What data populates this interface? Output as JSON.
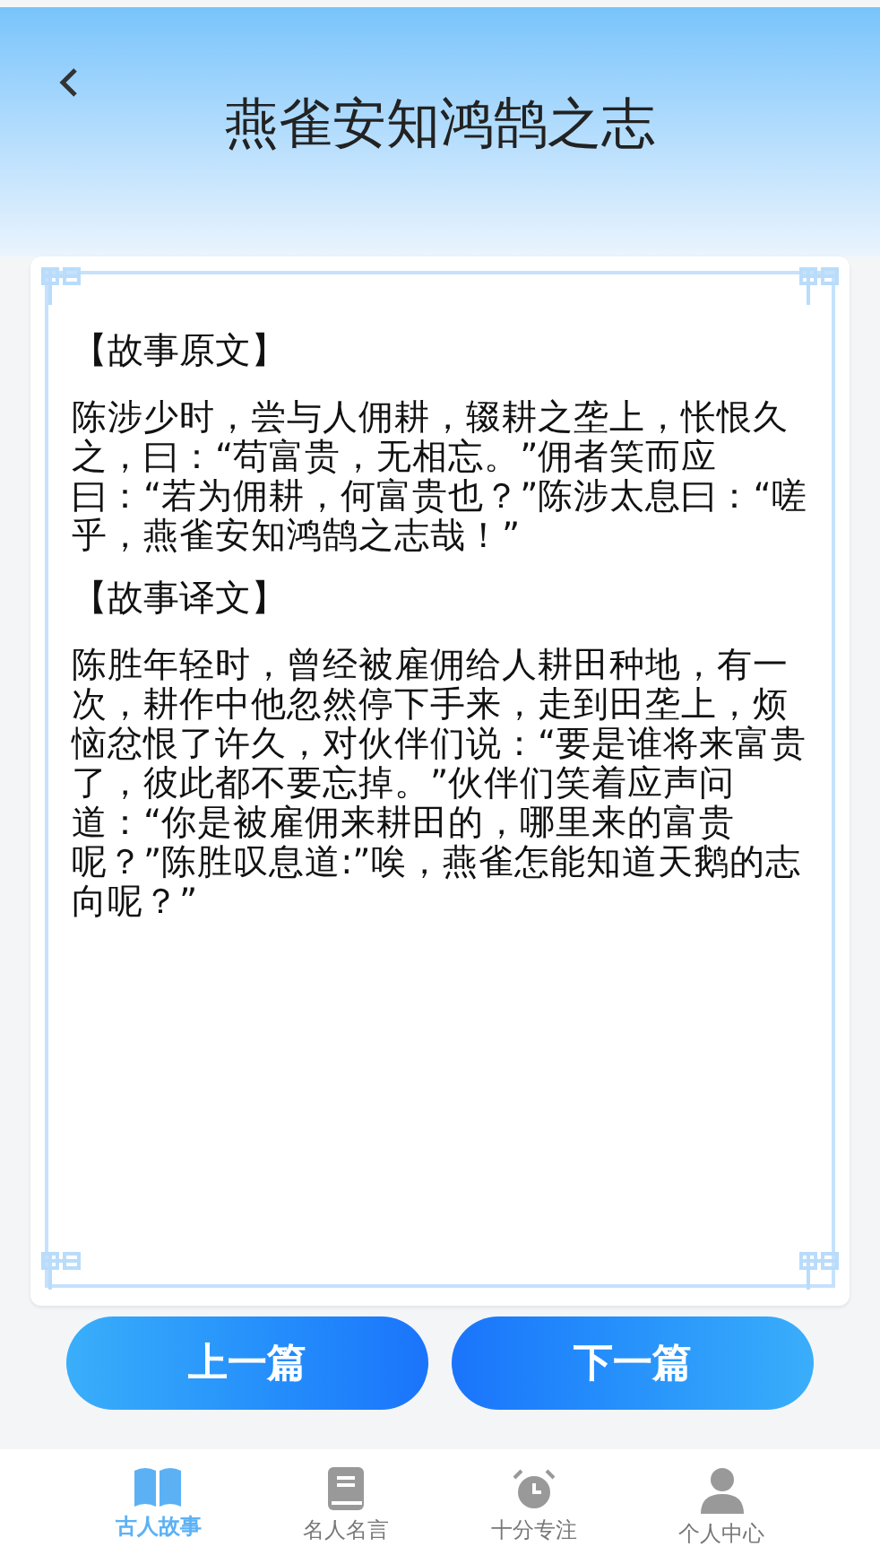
{
  "header": {
    "title": "燕雀安知鸿鹄之志"
  },
  "story": {
    "sections": [
      {
        "heading": "【故事原文】",
        "body": "陈涉少时，尝与人佣耕，辍耕之垄上，怅恨久之，曰：“苟富贵，无相忘。”佣者笑而应曰：“若为佣耕，何富贵也？”陈涉太息曰：“嗟乎，燕雀安知鸿鹄之志哉！”"
      },
      {
        "heading": "【故事译文】",
        "body": "陈胜年轻时，曾经被雇佣给人耕田种地，有一次，耕作中他忽然停下手来，走到田垄上，烦恼忿恨了许久，对伙伴们说：“要是谁将来富贵了，彼此都不要忘掉。”伙伴们笑着应声问道：“你是被雇佣来耕田的，哪里来的富贵呢？”陈胜叹息道:”唉，燕雀怎能知道天鹅的志向呢？”"
      }
    ]
  },
  "buttons": [
    {
      "label": "上一篇",
      "kind": "prev"
    },
    {
      "label": "下一篇",
      "kind": "next"
    }
  ],
  "tabs": [
    {
      "label": "古人故事",
      "kind": "book",
      "selected": true
    },
    {
      "label": "名人名言",
      "kind": "notebook",
      "selected": false
    },
    {
      "label": "十分专注",
      "kind": "alarm",
      "selected": false
    },
    {
      "label": "个人中心",
      "kind": "person",
      "selected": false
    }
  ]
}
